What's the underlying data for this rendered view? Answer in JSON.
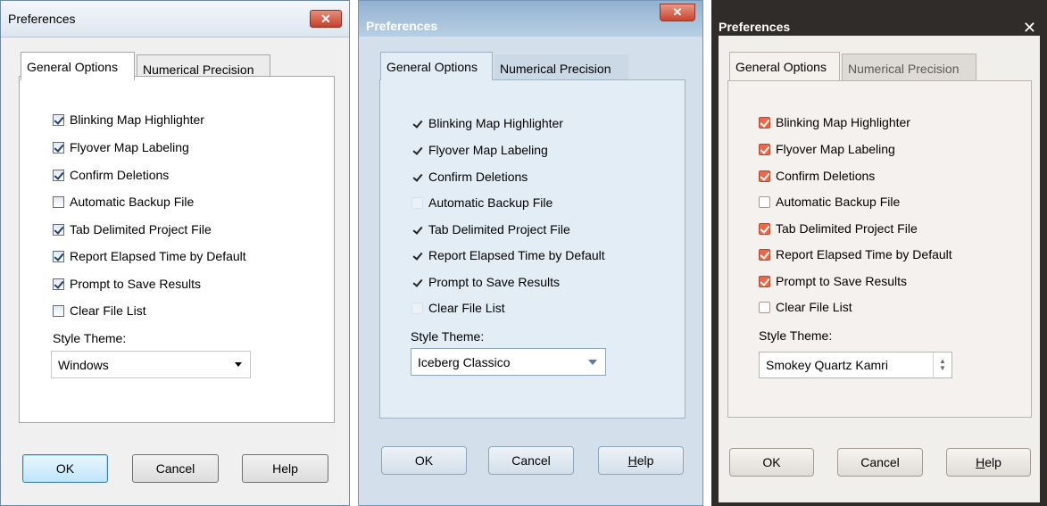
{
  "windows": [
    {
      "title": "Preferences",
      "close_glyph": "✕",
      "tabs": [
        "General Options",
        "Numerical Precision"
      ],
      "options": [
        {
          "label": "Blinking Map Highlighter",
          "checked": true
        },
        {
          "label": "Flyover Map Labeling",
          "checked": true
        },
        {
          "label": "Confirm Deletions",
          "checked": true
        },
        {
          "label": "Automatic Backup File",
          "checked": false
        },
        {
          "label": "Tab Delimited Project File",
          "checked": true
        },
        {
          "label": "Report Elapsed Time by Default",
          "checked": true
        },
        {
          "label": "Prompt to Save Results",
          "checked": true
        },
        {
          "label": "Clear File List",
          "checked": false
        }
      ],
      "theme_label": "Style Theme:",
      "theme_value": "Windows",
      "buttons": {
        "ok": "OK",
        "cancel": "Cancel",
        "help": "Help"
      }
    },
    {
      "title": "Preferences",
      "close_glyph": "✕",
      "tabs": [
        "General Options",
        "Numerical Precision"
      ],
      "options": [
        {
          "label": "Blinking Map Highlighter",
          "checked": true
        },
        {
          "label": "Flyover Map Labeling",
          "checked": true
        },
        {
          "label": "Confirm Deletions",
          "checked": true
        },
        {
          "label": "Automatic Backup File",
          "checked": false
        },
        {
          "label": "Tab Delimited Project File",
          "checked": true
        },
        {
          "label": "Report Elapsed Time by Default",
          "checked": true
        },
        {
          "label": "Prompt to Save Results",
          "checked": true
        },
        {
          "label": "Clear File List",
          "checked": false
        }
      ],
      "theme_label": "Style Theme:",
      "theme_value": "Iceberg Classico",
      "buttons": {
        "ok": "OK",
        "cancel": "Cancel",
        "help_mnemonic": "H",
        "help_rest": "elp"
      }
    },
    {
      "title": "Preferences",
      "close_glyph": "✕",
      "tabs": [
        "General Options",
        "Numerical Precision"
      ],
      "options": [
        {
          "label": "Blinking Map Highlighter",
          "checked": true
        },
        {
          "label": "Flyover Map Labeling",
          "checked": true
        },
        {
          "label": "Confirm Deletions",
          "checked": true
        },
        {
          "label": "Automatic Backup File",
          "checked": false
        },
        {
          "label": "Tab Delimited Project File",
          "checked": true
        },
        {
          "label": "Report Elapsed Time by Default",
          "checked": true
        },
        {
          "label": "Prompt to Save Results",
          "checked": true
        },
        {
          "label": "Clear File List",
          "checked": false
        }
      ],
      "theme_label": "Style Theme:",
      "theme_value": "Smokey Quartz Kamri",
      "buttons": {
        "ok": "OK",
        "cancel": "Cancel",
        "help_mnemonic": "H",
        "help_rest": "elp"
      }
    }
  ],
  "colors": {
    "windows_check": "#1c3d80",
    "iceberg_bg": "#d3dfea",
    "smokey_frame": "#2f2c29",
    "smokey_check_fill": "#e96a4a"
  },
  "icons": {
    "close": "close-icon",
    "dropdown": "chevron-down-icon",
    "spinner": "spinner-icon",
    "check": "checkmark-icon"
  }
}
